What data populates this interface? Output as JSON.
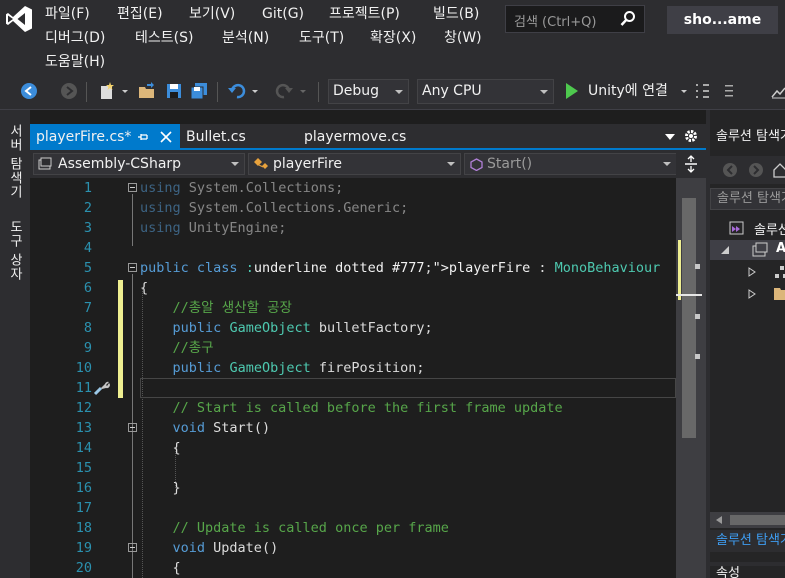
{
  "menu": {
    "row1": [
      "파일(F)",
      "편집(E)",
      "보기(V)",
      "Git(G)",
      "프로젝트(P)",
      "빌드(B)"
    ],
    "row2": [
      "디버그(D)",
      "테스트(S)",
      "분석(N)",
      "도구(T)",
      "확장(X)",
      "창(W)"
    ],
    "row3": [
      "도움말(H)"
    ],
    "search_placeholder": "검색 (Ctrl+Q)",
    "solution_name": "sho...ame"
  },
  "toolbar": {
    "config": "Debug",
    "platform": "Any CPU",
    "run_label": "Unity에 연결",
    "play_color": "#4ec94e"
  },
  "left_strip": {
    "server_explorer": "서버 탐색기",
    "toolbox": "도구 상자"
  },
  "tabs": [
    {
      "label": "playerFire.cs*",
      "active": true
    },
    {
      "label": "Bullet.cs",
      "active": false
    },
    {
      "label": "playermove.cs",
      "active": false
    }
  ],
  "navbar": {
    "project": "Assembly-CSharp",
    "class": "playerFire",
    "member": "Start()"
  },
  "editor": {
    "lines": [
      {
        "n": "1",
        "text": "using System.Collections;"
      },
      {
        "n": "2",
        "text": "using System.Collections.Generic;"
      },
      {
        "n": "3",
        "text": "using UnityEngine;"
      },
      {
        "n": "4",
        "text": ""
      },
      {
        "n": "5",
        "text": "public class playerFire : MonoBehaviour"
      },
      {
        "n": "6",
        "text": "{"
      },
      {
        "n": "7",
        "text": "    //총알 생산할 공장"
      },
      {
        "n": "8",
        "text": "    public GameObject bulletFactory;"
      },
      {
        "n": "9",
        "text": "    //총구"
      },
      {
        "n": "10",
        "text": "    public GameObject firePosition;"
      },
      {
        "n": "11",
        "text": ""
      },
      {
        "n": "12",
        "text": "    // Start is called before the first frame update"
      },
      {
        "n": "13",
        "text": "    void Start()"
      },
      {
        "n": "14",
        "text": "    {"
      },
      {
        "n": "15",
        "text": ""
      },
      {
        "n": "16",
        "text": "    }"
      },
      {
        "n": "17",
        "text": ""
      },
      {
        "n": "18",
        "text": "    // Update is called once per frame"
      },
      {
        "n": "19",
        "text": "    void Update()"
      },
      {
        "n": "20",
        "text": "    {"
      }
    ]
  },
  "solution_explorer": {
    "title": "솔루션 탐색기",
    "search": "솔루션 탐색기 검색",
    "root": "솔루션",
    "project": "Assembly-CSharp",
    "bottom_tab": "솔루션 탐색기",
    "bottom_next": "속성"
  }
}
